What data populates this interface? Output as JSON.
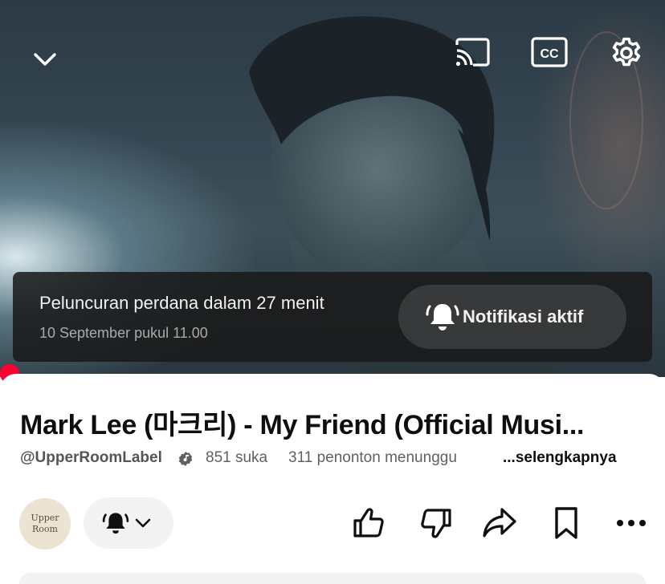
{
  "player": {
    "collapse_icon": "chevron-down-icon",
    "cast_icon": "cast-icon",
    "cc_icon": "closed-captions-icon",
    "settings_icon": "gear-icon",
    "premiere": {
      "title": "Peluncuran perdana dalam 27 menit",
      "date": "10 September pukul 11.00",
      "notify_label": "Notifikasi aktif",
      "notify_icon": "bell-ringing-icon"
    },
    "progress_color": "#ff0033"
  },
  "video": {
    "title": "Mark Lee (마크리) - My Friend (Official Musi...",
    "channel_handle": "@UpperRoomLabel",
    "verified_icon": "verified-music-icon",
    "likes": "851 suka",
    "waiting": "311 penonton menunggu",
    "more_label": "...selengkapnya"
  },
  "channel": {
    "avatar_line1": "Upper",
    "avatar_line2": "Room",
    "subscribe_icon": "bell-filled-icon"
  },
  "actions": {
    "like_icon": "thumbs-up-icon",
    "dislike_icon": "thumbs-down-icon",
    "share_icon": "share-icon",
    "save_icon": "bookmark-icon",
    "more_icon": "more-horizontal-icon"
  }
}
